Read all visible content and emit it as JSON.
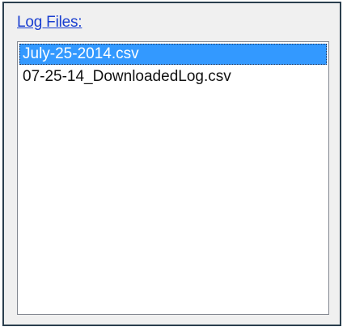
{
  "log_files": {
    "label": "Log Files:",
    "items": [
      {
        "name": "July-25-2014.csv",
        "selected": true
      },
      {
        "name": "07-25-14_DownloadedLog.csv",
        "selected": false
      }
    ]
  },
  "colors": {
    "selection": "#3399ff",
    "label": "#1a3fd0",
    "border": "#2b3f4e"
  }
}
